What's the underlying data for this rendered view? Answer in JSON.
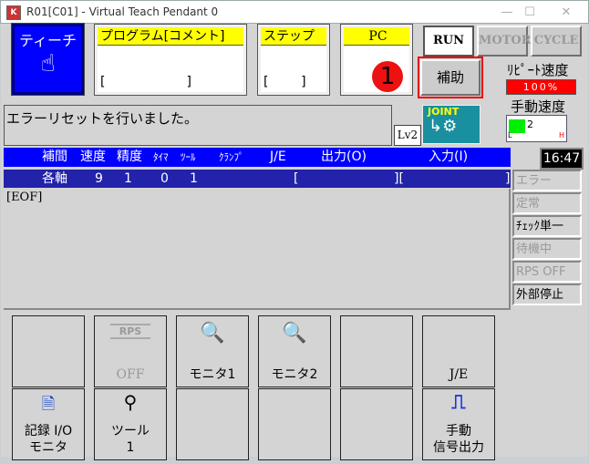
{
  "window": {
    "title": "R01[C01] - Virtual Teach Pendant 0",
    "app_icon": "K",
    "minimize": "—",
    "maximize": "☐",
    "close": "✕"
  },
  "top": {
    "teach_label": "ティーチ",
    "program_label": "プログラム[コメント]",
    "program_value": "[                    ]",
    "step_label": "ステップ",
    "step_value": "[        ]",
    "pc_label": "PC",
    "run": "RUN",
    "motor": "MOTOR",
    "cycle": "CYCLE",
    "aux_button": "補助",
    "marker": "1",
    "repeat_speed_label": "ﾘﾋﾟｰﾄ速度",
    "repeat_speed_value": "100%",
    "manual_speed_label": "手動速度",
    "manual_speed_value": "2",
    "manual_speed_low": "L",
    "manual_speed_high": "H",
    "level": "Lv2",
    "joint_label": "JOINT"
  },
  "message": "エラーリセットを行いました。",
  "clock": "16:47",
  "header_row": [
    "補間",
    "速度",
    "精度",
    "ﾀｲﾏ",
    "ﾂｰﾙ",
    "ｸﾗﾝﾌﾟ",
    "J/E",
    "出力(O)",
    "入力(I)"
  ],
  "value_row": {
    "interp": "各軸",
    "speed": "9",
    "accuracy": "1",
    "timer": "0",
    "tool": "1",
    "out": "[",
    "out_end": "][",
    "in_end": "]"
  },
  "program_text": "[EOF]",
  "status": [
    {
      "label": "エラー",
      "active": false
    },
    {
      "label": "定常",
      "active": false
    },
    {
      "label": "ﾁｪｯｸ単一",
      "active": true
    },
    {
      "label": "待機中",
      "active": false
    },
    {
      "label": "RPS OFF",
      "active": false
    },
    {
      "label": "外部停止",
      "active": true
    }
  ],
  "function_buttons": {
    "rps_icon": "RPS",
    "rps": "OFF",
    "monitor1": "モニタ1",
    "monitor2": "モニタ2",
    "je": "J/E",
    "log_io_1": "記録 I/O",
    "log_io_2": "モニタ",
    "tool_1": "ツール",
    "tool_2": "1",
    "manual_sig_1": "手動",
    "manual_sig_2": "信号出力"
  },
  "colors": {
    "teach_blue": "#0000ff",
    "header_blue": "#0000ff",
    "row_blue": "#2222aa",
    "yellow": "#ffff00",
    "speed_red": "#ff0000",
    "marker_red": "#ee1111",
    "gauge_green": "#00ee00",
    "joint_teal": "#1a8fa0"
  }
}
